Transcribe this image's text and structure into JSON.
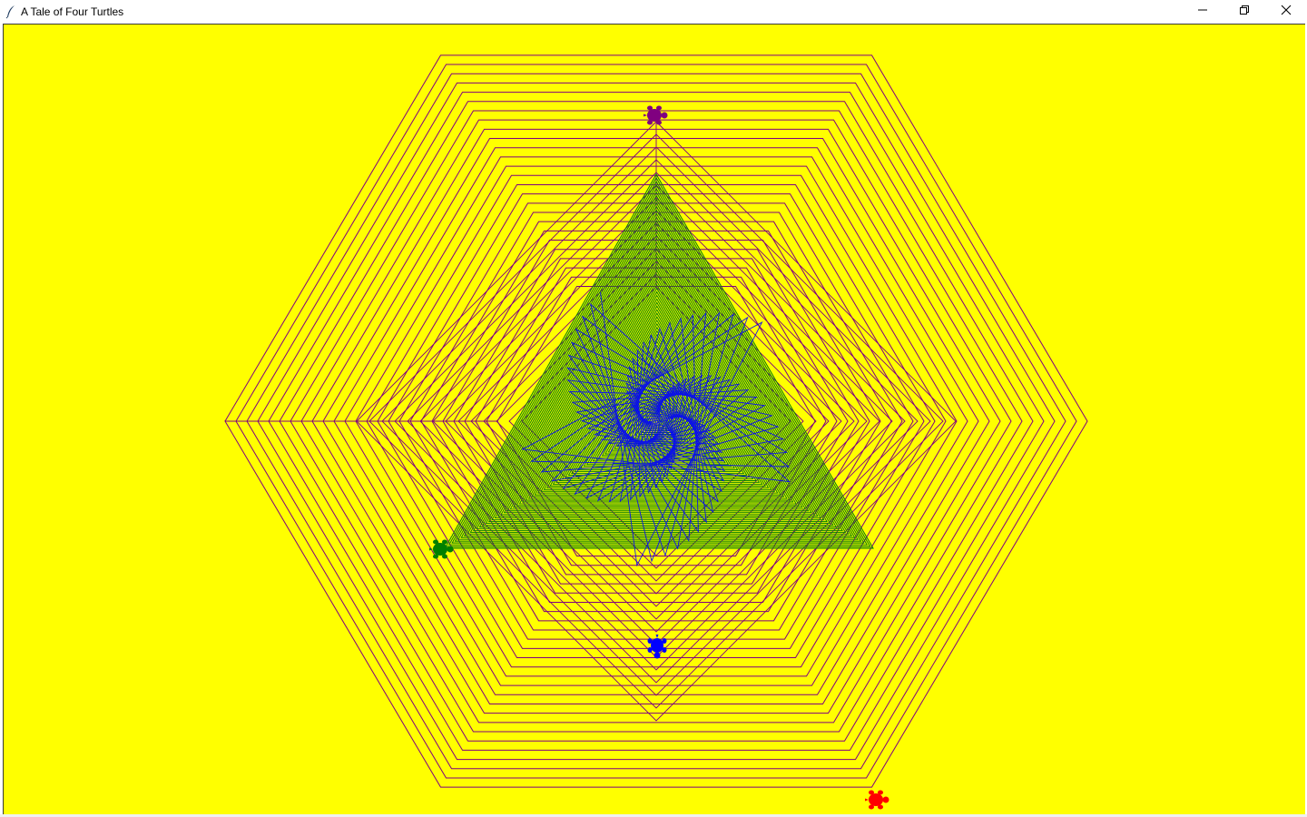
{
  "window": {
    "title": "A Tale of Four Turtles",
    "icon": "feather-icon",
    "controls": [
      "minimize-icon",
      "restore-icon",
      "close-icon"
    ]
  },
  "canvas": {
    "background": "#ffff00",
    "turtles": [
      {
        "name": "purple",
        "color": "#800080"
      },
      {
        "name": "green",
        "color": "#008000"
      },
      {
        "name": "blue",
        "color": "#0000ff"
      },
      {
        "name": "red",
        "color": "#ff0000"
      }
    ],
    "hexagon_color": "#800080",
    "triangle_color": "#008000",
    "star_color": "#0000ff"
  }
}
